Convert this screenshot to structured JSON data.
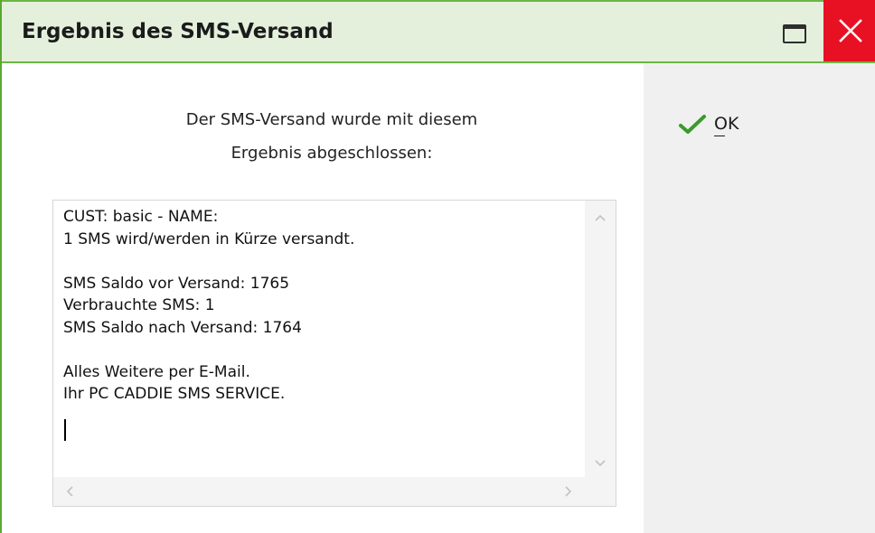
{
  "window": {
    "title": "Ergebnis des SMS-Versand"
  },
  "message": {
    "line1": "Der SMS-Versand wurde mit diesem",
    "line2": "Ergebnis abgeschlossen:"
  },
  "result_text": {
    "lines": [
      "CUST: basic - NAME:",
      "1 SMS wird/werden in Kürze versandt.",
      "",
      "SMS Saldo vor Versand: 1765",
      "Verbrauchte SMS: 1",
      "SMS Saldo nach Versand: 1764",
      "",
      "Alles Weitere per E-Mail.",
      "Ihr PC CADDIE SMS SERVICE."
    ]
  },
  "buttons": {
    "ok_label": "OK"
  },
  "icons": {
    "ok": "checkmark-icon",
    "close": "close-icon",
    "maximize": "maximize-icon"
  },
  "colors": {
    "titlebar_bg": "#e4f0dc",
    "titlebar_border": "#6cb544",
    "close_bg": "#e81123",
    "checkmark": "#3a9a2a",
    "side_panel_bg": "#f0f0f0"
  }
}
